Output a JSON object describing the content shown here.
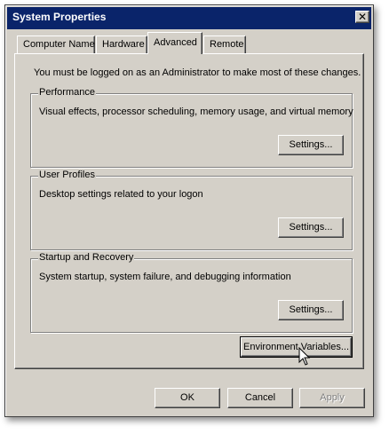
{
  "window": {
    "title": "System Properties",
    "close_glyph": "✕"
  },
  "tabs": [
    {
      "label": "Computer Name",
      "active": false
    },
    {
      "label": "Hardware",
      "active": false
    },
    {
      "label": "Advanced",
      "active": true
    },
    {
      "label": "Remote",
      "active": false
    }
  ],
  "advanced": {
    "admin_note": "You must be logged on as an Administrator to make most of these changes.",
    "performance": {
      "title": "Performance",
      "description": "Visual effects, processor scheduling, memory usage, and virtual memory",
      "button": "Settings..."
    },
    "user_profiles": {
      "title": "User Profiles",
      "description": "Desktop settings related to your logon",
      "button": "Settings..."
    },
    "startup_recovery": {
      "title": "Startup and Recovery",
      "description": "System startup, system failure, and debugging information",
      "button": "Settings..."
    },
    "env_vars_button": "Environment Variables..."
  },
  "footer": {
    "ok": "OK",
    "cancel": "Cancel",
    "apply": "Apply"
  },
  "icons": {
    "close": "close-icon",
    "cursor": "mouse-pointer-icon"
  },
  "colors": {
    "titlebar": "#0a246a",
    "face": "#d4d0c8",
    "disabled_text": "#808080"
  }
}
